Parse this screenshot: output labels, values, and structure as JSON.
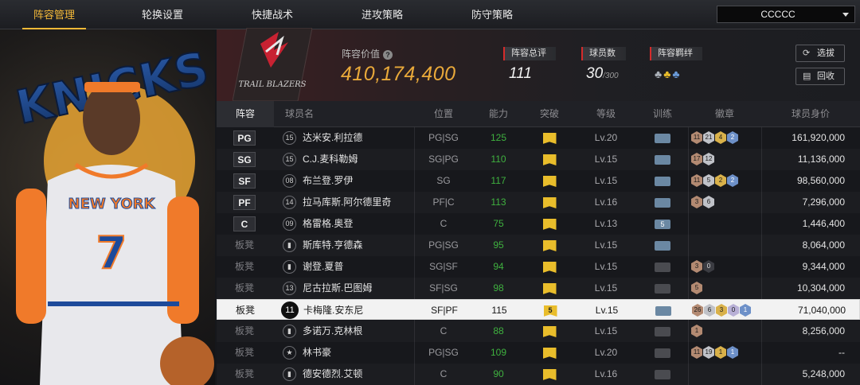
{
  "nav": {
    "tabs": [
      {
        "label": "阵容管理",
        "active": true
      },
      {
        "label": "轮换设置",
        "active": false
      },
      {
        "label": "快捷战术",
        "active": false
      },
      {
        "label": "进攻策略",
        "active": false
      },
      {
        "label": "防守策略",
        "active": false
      }
    ],
    "team_select": "CCCCC"
  },
  "portrait": {
    "logo_text": "KNICKS",
    "jersey_team": "NEW YORK",
    "jersey_number": "7"
  },
  "summary": {
    "team_logo_text": "TRAIL BLAZERS",
    "lineup_value_label": "阵容价值",
    "lineup_value": "410,174,400",
    "overall_label": "阵容总评",
    "overall_value": "111",
    "players_label": "球员数",
    "players_value": "30",
    "players_max": "/300",
    "bond_label": "阵容羁绊",
    "scout_button": "选拔",
    "recycle_button": "回收"
  },
  "table": {
    "headers": {
      "lineup": "阵容",
      "name": "球员名",
      "position": "位置",
      "ability": "能力",
      "breakthrough": "突破",
      "level": "等级",
      "training": "训练",
      "badges": "徽章",
      "value": "球员身价"
    },
    "rows": [
      {
        "slot": "PG",
        "number": "15",
        "name": "达米安.利拉德",
        "pos": "PG|SG",
        "ability": "125",
        "break": "",
        "level": "Lv.20",
        "train": "on",
        "badges": [
          [
            "b",
            "11"
          ],
          [
            "s",
            "21"
          ],
          [
            "g",
            "4"
          ],
          [
            "p",
            "2"
          ]
        ],
        "value": "161,920,000"
      },
      {
        "slot": "SG",
        "number": "15",
        "name": "C.J.麦科勒姆",
        "pos": "SG|PG",
        "ability": "110",
        "break": "",
        "level": "Lv.15",
        "train": "on",
        "badges": [
          [
            "b",
            "17"
          ],
          [
            "s",
            "12"
          ]
        ],
        "value": "11,136,000"
      },
      {
        "slot": "SF",
        "number": "08",
        "name": "布兰登.罗伊",
        "pos": "SG",
        "ability": "117",
        "break": "",
        "level": "Lv.15",
        "train": "on",
        "badges": [
          [
            "b",
            "11"
          ],
          [
            "s",
            "5"
          ],
          [
            "g",
            "2"
          ],
          [
            "p",
            "2"
          ]
        ],
        "value": "98,560,000"
      },
      {
        "slot": "PF",
        "number": "14",
        "name": "拉马库斯.阿尔德里奇",
        "pos": "PF|C",
        "ability": "113",
        "break": "",
        "level": "Lv.16",
        "train": "on",
        "badges": [
          [
            "b",
            "3"
          ],
          [
            "s",
            "6"
          ]
        ],
        "value": "7,296,000"
      },
      {
        "slot": "C",
        "number": "09",
        "name": "格雷格.奥登",
        "pos": "C",
        "ability": "75",
        "break": "",
        "level": "Lv.13",
        "train": "5",
        "badges": [],
        "value": "1,446,400"
      },
      {
        "slot": "板凳",
        "number": "",
        "name": "斯库特.亨德森",
        "pos": "PG|SG",
        "ability": "95",
        "break": "",
        "level": "Lv.15",
        "train": "on",
        "badges": [],
        "value": "8,064,000"
      },
      {
        "slot": "板凳",
        "number": "",
        "name": "谢登.夏普",
        "pos": "SG|SF",
        "ability": "94",
        "break": "",
        "level": "Lv.15",
        "train": "off",
        "badges": [
          [
            "b",
            "3"
          ],
          [
            "d",
            "0"
          ]
        ],
        "value": "9,344,000"
      },
      {
        "slot": "板凳",
        "number": "13",
        "name": "尼古拉斯.巴图姆",
        "pos": "SF|SG",
        "ability": "98",
        "break": "",
        "level": "Lv.15",
        "train": "off",
        "badges": [
          [
            "b",
            "5"
          ]
        ],
        "value": "10,304,000"
      },
      {
        "slot": "板凳",
        "number": "11",
        "name": "卡梅隆.安东尼",
        "pos": "SF|PF",
        "ability": "115",
        "break": "5",
        "level": "Lv.15",
        "train": "on",
        "badges": [
          [
            "b",
            "26"
          ],
          [
            "s",
            "6"
          ],
          [
            "g",
            "3"
          ],
          [
            "v",
            "0"
          ],
          [
            "p",
            "1"
          ]
        ],
        "value": "71,040,000",
        "selected": true
      },
      {
        "slot": "板凳",
        "number": "",
        "name": "多诺万.克林根",
        "pos": "C",
        "ability": "88",
        "break": "",
        "level": "Lv.15",
        "train": "off",
        "badges": [
          [
            "b",
            "1"
          ]
        ],
        "value": "8,256,000"
      },
      {
        "slot": "板凳",
        "number": "★",
        "name": "林书豪",
        "pos": "PG|SG",
        "ability": "109",
        "break": "",
        "level": "Lv.20",
        "train": "off",
        "badges": [
          [
            "b",
            "11"
          ],
          [
            "s",
            "19"
          ],
          [
            "g",
            "1"
          ],
          [
            "p",
            "1"
          ]
        ],
        "value": "--"
      },
      {
        "slot": "板凳",
        "number": "",
        "name": "德安德烈.艾顿",
        "pos": "C",
        "ability": "90",
        "break": "",
        "level": "Lv.16",
        "train": "off",
        "badges": [],
        "value": "5,248,000"
      }
    ]
  },
  "colors": {
    "accent": "#f4b938",
    "value_gold": "#e9a93a",
    "ability_green": "#3fb13f",
    "stat_red": "#d52b2b"
  }
}
